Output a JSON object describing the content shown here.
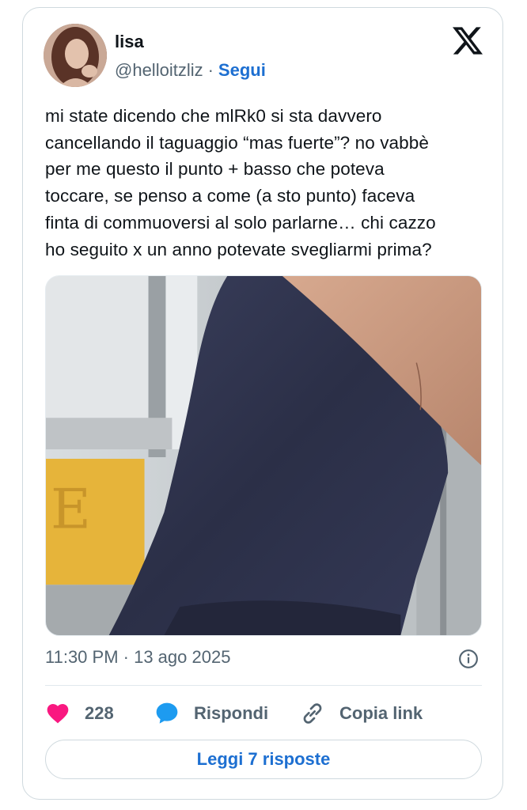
{
  "tweet": {
    "author_name": "lisa",
    "author_handle": "@helloitzliz",
    "separator": "·",
    "follow_label": "Segui",
    "text": "mi state dicendo che mlRk0 si sta davvero\ncancellando il taguaggio “mas fuerte”? no vabbè\nper me questo il punto + basso che poteva\ntoccare, se penso a come (a sto punto) faceva\nfinta di commuoversi al solo parlarne… chi cazzo\nho seguito x un anno potevate svegliarmi prima?",
    "timestamp": "11:30 PM · 13 ago 2025",
    "likes_count": "228",
    "reply_label": "Rispondi",
    "copy_link_label": "Copia link",
    "read_replies_label": "Leggi 7 risposte"
  },
  "colors": {
    "like": "#f91880",
    "reply": "#1d9bf0",
    "link_text": "#1d6fd1",
    "muted": "#536471",
    "border": "#cfd9de"
  },
  "icons": {
    "brand": "x-logo-icon",
    "like": "heart-icon",
    "reply": "speech-bubble-icon",
    "copy_link": "link-icon",
    "info": "info-icon"
  }
}
